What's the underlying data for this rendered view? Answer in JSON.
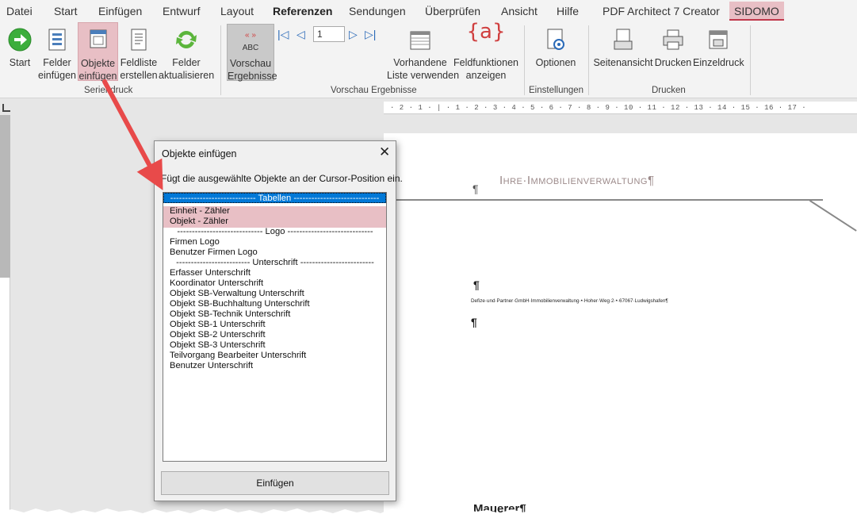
{
  "menu": {
    "tabs": [
      "Datei",
      "Start",
      "Einfügen",
      "Entwurf",
      "Layout",
      "Referenzen",
      "Sendungen",
      "Überprüfen",
      "Ansicht",
      "Hilfe",
      "PDF Architect 7 Creator",
      "SIDOMO"
    ]
  },
  "ribbon": {
    "start_label": "Start",
    "felder_einfuegen_label1": "Felder",
    "felder_einfuegen_label2": "einfügen",
    "objekte_einfuegen_label1": "Objekte",
    "objekte_einfuegen_label2": "einfügen",
    "feldliste_label1": "Feldliste",
    "feldliste_label2": "erstellen",
    "felder_akt_label1": "Felder",
    "felder_akt_label2": "aktualisieren",
    "group_seriendruck": "Seriendruck",
    "vorschau_label1": "Vorschau",
    "vorschau_label2": "Ergebnisse",
    "vorschau_icon_text": "ABC",
    "record_value": "1",
    "vorhandene_label1": "Vorhandene",
    "vorhandene_label2": "Liste verwenden",
    "feldfunktionen_label1": "Feldfunktionen",
    "feldfunktionen_label2": "anzeigen",
    "group_vorschau": "Vorschau Ergebnisse",
    "optionen_label": "Optionen",
    "group_einstellungen": "Einstellungen",
    "seitenansicht_label": "Seitenansicht",
    "drucken_label": "Drucken",
    "einzeldruck_label": "Einzeldruck",
    "group_drucken": "Drucken"
  },
  "ruler": {
    "h_text": "· 2 · 1 · | · 1 · 2 · 3 · 4 · 5 · 6 · 7 · 8 · 9 · 10 · 11 · 12 · 13 · 14 · 15 · 16 · 17 ·"
  },
  "document": {
    "title": "Ihre·Immobilienverwaltung¶",
    "pilcrow": "¶",
    "address": "Defize·und·Partner·GmbH·Immobilienverwaltung·•·Hoher·Weg·2·•·67067·Ludwigshafen¶",
    "mauerer": "Mauerer¶"
  },
  "dialog": {
    "title": "Objekte einfügen",
    "close": "✕",
    "description": "Fügt die ausgewählte Objekte an der Cursor-Position ein.",
    "items": [
      "----------------------------- Tabellen -----------------------------",
      "Einheit - Zähler",
      "Objekt - Zähler",
      "----------------------------- Logo -----------------------------",
      "Firmen Logo",
      "Benutzer Firmen Logo",
      "------------------------- Unterschrift -------------------------",
      "Erfasser Unterschrift",
      "Koordinator Unterschrift",
      "Objekt SB-Verwaltung Unterschrift",
      "Objekt SB-Buchhaltung Unterschrift",
      "Objekt SB-Technik Unterschrift",
      "Objekt SB-1 Unterschrift",
      "Objekt SB-2 Unterschrift",
      "Objekt SB-3 Unterschrift",
      "Teilvorgang Bearbeiter Unterschrift",
      "Benutzer Unterschrift"
    ],
    "button": "Einfügen"
  },
  "colors": {
    "highlight": "#e8bfc5",
    "selection": "#0078d7",
    "arrow": "#e84a4a",
    "accent_green": "#3cae3c"
  }
}
